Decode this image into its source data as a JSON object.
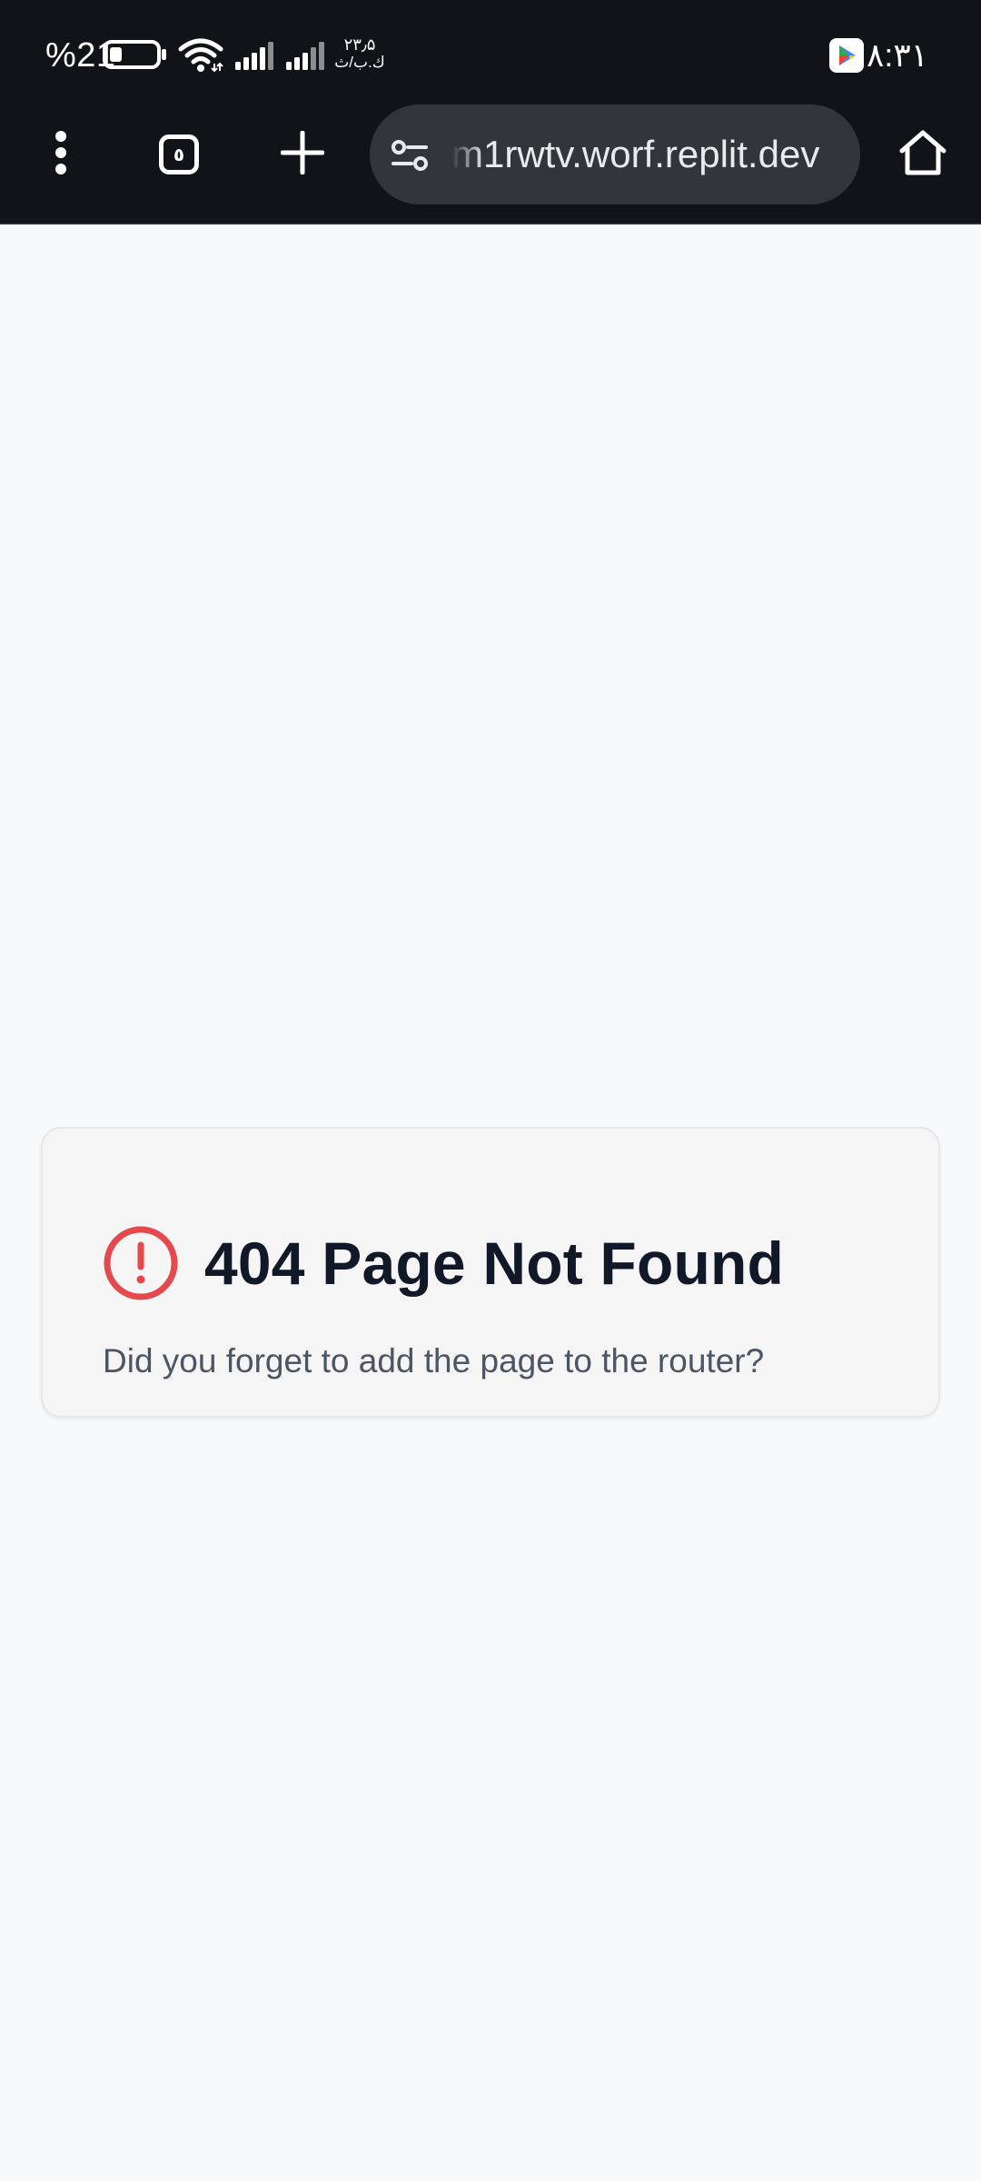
{
  "status_bar": {
    "battery_percent": "%21",
    "battery_level": 0.21,
    "data_speed_value": "۲۳٫۵",
    "data_speed_unit": "ك.ب/ث",
    "time": "٨:٣١",
    "icons": [
      "battery-icon",
      "wifi-icon",
      "signal-icon",
      "signal-icon",
      "play-store-icon"
    ]
  },
  "browser_toolbar": {
    "tab_count": "٥",
    "url": "m1rwtv.worf.replit.dev",
    "icons": [
      "more-vert-icon",
      "tabs-icon",
      "plus-icon",
      "site-settings-icon",
      "home-icon"
    ]
  },
  "error_card": {
    "title": "404 Page Not Found",
    "message": "Did you forget to add the page to the router?",
    "icon": "alert-circle-icon",
    "icon_color": "#e5484d"
  },
  "colors": {
    "chrome_background": "#121318",
    "omnibox_background": "#34353a",
    "page_background": "#f8f9fa",
    "card_background": "#f5f5f5",
    "title_color": "#111827",
    "message_color": "#4b5563"
  }
}
